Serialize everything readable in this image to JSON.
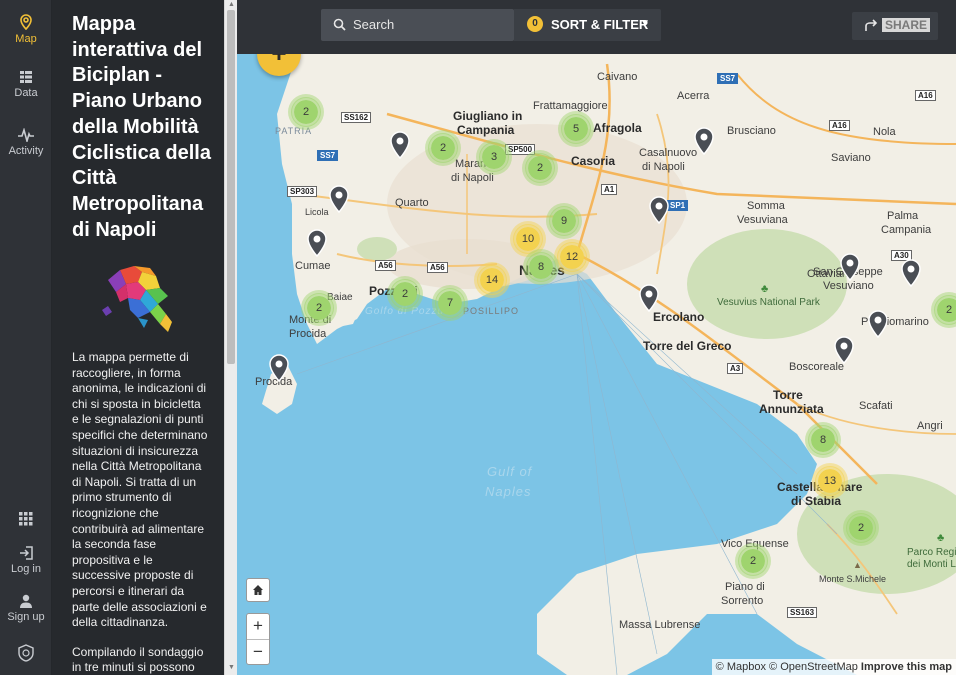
{
  "rail": {
    "map": "Map",
    "data": "Data",
    "activity": "Activity",
    "login": "Log in",
    "signup": "Sign up"
  },
  "panel": {
    "title": "Mappa interattiva del Biciplan - Piano Urbano della Mobilità Ciclistica della Città Metropolitana di Napoli",
    "paragraph1": "La mappa permette di raccogliere, in forma anonima, le indicazioni di chi si sposta in bicicletta e le segnalazioni di punti specifici che determinano situazioni di insicurezza nella Città Metropolitana di Napoli. Si tratta di un primo strumento di ricognizione che contribuirà ad alimentare la seconda fase propositiva e le successive proposte di percorsi e itinerari da parte delle associazioni e della cittadinanza.",
    "paragraph2": "Compilando il sondaggio in tre minuti si possono"
  },
  "topbar": {
    "search_label": "Search",
    "filter_count": "0",
    "filter_label": "SORT & FILTER",
    "share_label": "SHARE"
  },
  "map": {
    "attribution_mapbox": "© Mapbox",
    "attribution_osm": "© OpenStreetMap",
    "attribution_improve": "Improve this map",
    "places": {
      "caivano": "Caivano",
      "acerra": "Acerra",
      "giugliano": "Giugliano in",
      "campania": "Campania",
      "frattamaggiore": "Frattamaggiore",
      "afragola": "Afragola",
      "brusciano": "Brusciano",
      "nola": "Nola",
      "casalnuovo": "Casalnuovo",
      "dinapoli": "di Napoli",
      "saviano": "Saviano",
      "casoria": "Casoria",
      "marano": "Marano",
      "maranonapoli": "di Napoli",
      "quarto": "Quarto",
      "licola": "Licola",
      "somma": "Somma",
      "vesuviana": "Vesuviana",
      "palma": "Palma",
      "campania2": "Campania",
      "cumae": "Cumae",
      "ottaviano": "Ottaviano",
      "sangiuseppe": "San Giuseppe",
      "vesuviano": "Vesuviano",
      "napoli": "Naples",
      "pozzuoli": "Pozzuoli",
      "golfopozzuoli": "Golfo di Pozzuoli",
      "posillipo": "POSILLIPO",
      "baiae": "Baiae",
      "montedi": "Monte di",
      "procida_m": "Procida",
      "procida": "Procida",
      "ercolano": "Ercolano",
      "vesuviuspark": "Vesuvius National Park",
      "torredelgreco": "Torre del Greco",
      "poggiomarino": "Poggiomarino",
      "boscoreale": "Boscoreale",
      "torreannunziata": "Torre",
      "annunziata": "Annunziata",
      "scafati": "Scafati",
      "angri": "Angri",
      "gulf": "Gulf of",
      "ofnaples": "Naples",
      "castellammare": "Castellammare",
      "distabia": "di Stabia",
      "vicoequense": "Vico Equense",
      "pianodi": "Piano di",
      "sorrento": "Sorrento",
      "parco": "Parco Regio",
      "deimonti": "dei Monti La",
      "montesmichele": "Monte S.Michele",
      "massalubrense": "Massa Lubrense",
      "patria": "PATRIA"
    },
    "roads": {
      "ss162": "SS162",
      "ss7": "SS7",
      "sp500": "SP500",
      "a1": "A1",
      "sp303": "SP303",
      "a56a": "A56",
      "a56b": "A56",
      "sp1": "SP1",
      "a16a": "A16",
      "a16b": "A16",
      "a30": "A30",
      "a3": "A3",
      "ss163": "SS163",
      "ss7b": "SS7"
    },
    "clusters": [
      "2",
      "2",
      "3",
      "5",
      "2",
      "9",
      "10",
      "12",
      "8",
      "14",
      "2",
      "7",
      "2",
      "8",
      "13",
      "2",
      "2",
      "2"
    ]
  },
  "colors": {
    "accent": "#f2c037",
    "sidebar": "#26292d",
    "cluster_green": "#9fd46e",
    "cluster_yellow": "#f3d24f",
    "pin": "#4a4e55"
  }
}
